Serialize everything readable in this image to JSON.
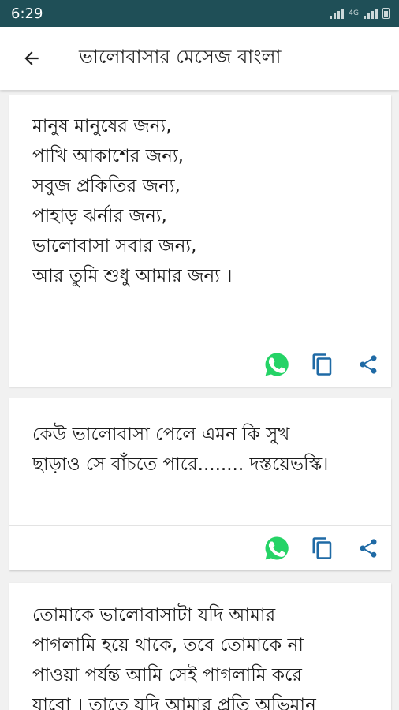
{
  "status_bar": {
    "time": "6:29",
    "network": "4G"
  },
  "app_bar": {
    "title": "ভালোবাসার মেসেজ বাংলা",
    "back_icon": "arrow-back-icon"
  },
  "colors": {
    "status_bar": "#1f4f57",
    "whatsapp": "#25d366",
    "action_icon": "#1f6aa5"
  },
  "cards": [
    {
      "text": "মানুষ মানুষের জন্য,\nপাখি আকাশের জন্য,\nসবুজ প্রকিতির জন্য,\nপাহাড় ঝর্নার জন্য,\nভালোবাসা সবার জন্য,\nআর তুমি শুধু আমার জন্য ।",
      "actions": [
        "whatsapp-icon",
        "copy-icon",
        "share-icon"
      ]
    },
    {
      "text": "কেউ ভালোবাসা পেলে এমন কি সুখ\nছাড়াও সে বাঁচতে পারে........ দস্তয়েভস্কি।",
      "actions": [
        "whatsapp-icon",
        "copy-icon",
        "share-icon"
      ]
    },
    {
      "text": "তোমাকে ভালোবাসাটা যদি আমার\nপাগলামি হয়ে থাকে, তবে তোমাকে না\nপাওয়া পর্যন্ত আমি সেই পাগলামি করে\nযাবো । তাতে যদি আমার প্রতি অভিমান"
    }
  ]
}
